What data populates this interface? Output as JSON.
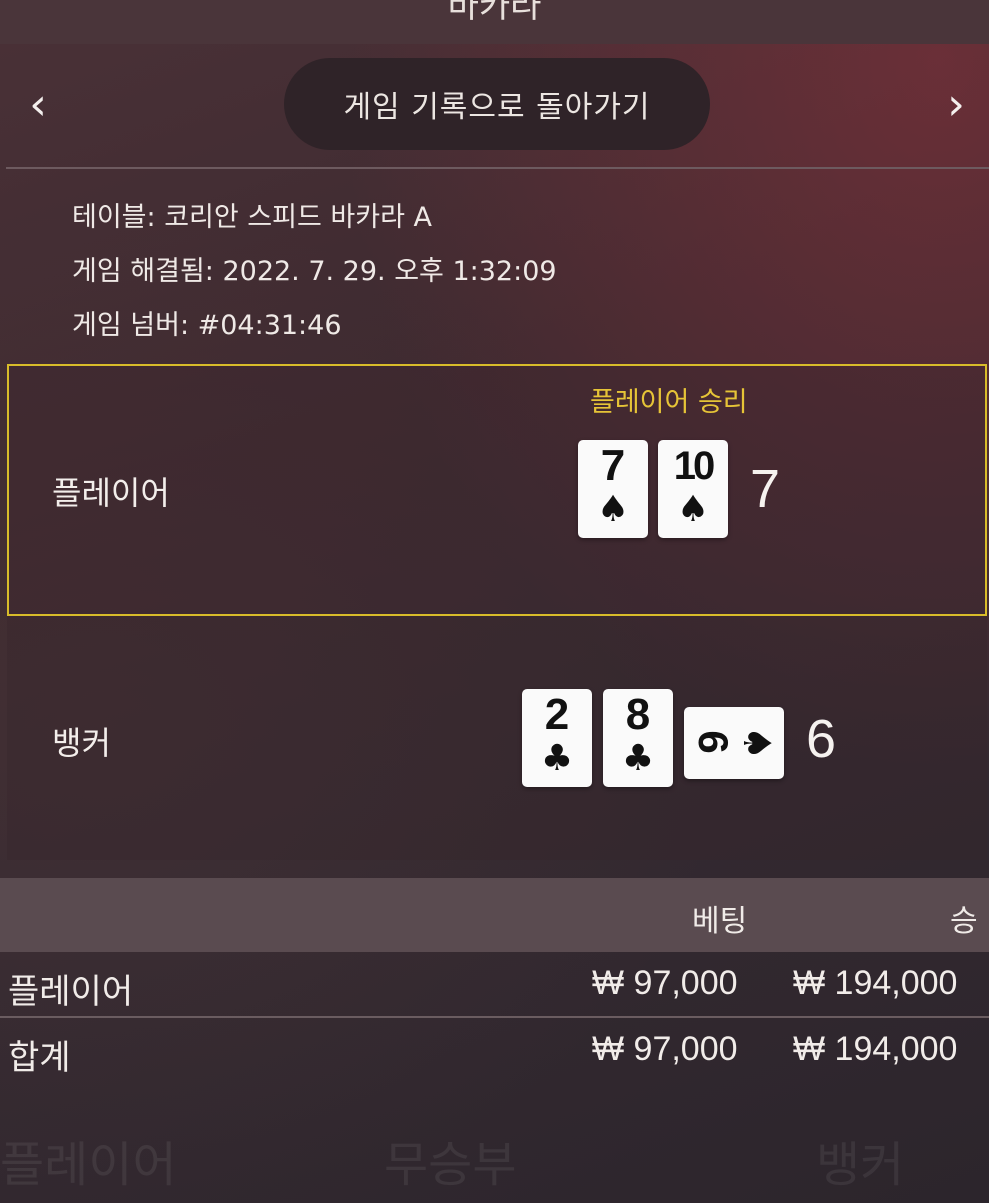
{
  "header": {
    "title": "바카라"
  },
  "nav": {
    "prev_icon": "chevron-left-icon",
    "next_icon": "chevron-right-icon",
    "prev_glyph": "‹",
    "next_glyph": "›"
  },
  "back_button": {
    "label": "게임 기록으로 돌아가기"
  },
  "info": {
    "table": "테이블: 코리안 스피드 바카라 A",
    "resolved": "게임 해결됨: 2022. 7. 29. 오후 1:32:09",
    "number": "게임 넘버: #04:31:46"
  },
  "player": {
    "label": "플레이어",
    "result": "플레이어 승리",
    "score": "7",
    "cards": [
      {
        "rank": "7",
        "suit": "♠"
      },
      {
        "rank": "10",
        "suit": "♠"
      }
    ]
  },
  "banker": {
    "label": "뱅커",
    "score": "6",
    "cards": [
      {
        "rank": "2",
        "suit": "♣"
      },
      {
        "rank": "8",
        "suit": "♣"
      },
      {
        "rank": "6",
        "suit": "♠"
      }
    ]
  },
  "bets_table": {
    "headers": {
      "bet": "베팅",
      "win": "승"
    },
    "rows": [
      {
        "label": "플레이어",
        "bet": "₩ 97,000",
        "win": "₩ 194,000"
      },
      {
        "label": "합계",
        "bet": "₩ 97,000",
        "win": "₩ 194,000"
      }
    ]
  },
  "background_labels": [
    "플레이어",
    "무승부",
    "뱅커"
  ],
  "colors": {
    "accent_gold": "#d8bc2a",
    "win_text": "#e6c437",
    "background": "#3d2a30"
  }
}
